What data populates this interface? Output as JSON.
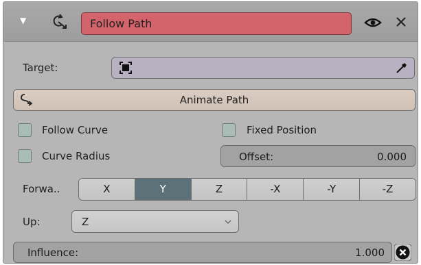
{
  "header": {
    "constraint_name": "Follow Path",
    "icons": [
      "triangle-down-icon",
      "follow-path-constraint-icon",
      "eye-icon",
      "close-icon"
    ]
  },
  "target": {
    "label": "Target:",
    "icons": [
      "object-icon",
      "eyedropper-icon"
    ]
  },
  "animate_path": {
    "label": "Animate Path",
    "icon": "animate-path-icon"
  },
  "options": {
    "follow_curve": {
      "label": "Follow Curve",
      "checked": false
    },
    "fixed_position": {
      "label": "Fixed Position",
      "checked": false
    },
    "curve_radius": {
      "label": "Curve Radius",
      "checked": false
    }
  },
  "offset": {
    "label": "Offset:",
    "value": "0.000"
  },
  "forward": {
    "label": "Forwa..",
    "axes": [
      "X",
      "Y",
      "Z",
      "-X",
      "-Y",
      "-Z"
    ],
    "selected": "Y"
  },
  "up": {
    "label": "Up:",
    "value": "Z"
  },
  "influence": {
    "label": "Influence:",
    "value": "1.000"
  },
  "colors": {
    "panel_bg": "#b6b6b6",
    "name_field": "#d4646b",
    "target_field": "#b7b1c2",
    "animate_button": "#d6c8bc",
    "checkbox": "#a9bdb6",
    "active_axis": "#5d7178"
  }
}
